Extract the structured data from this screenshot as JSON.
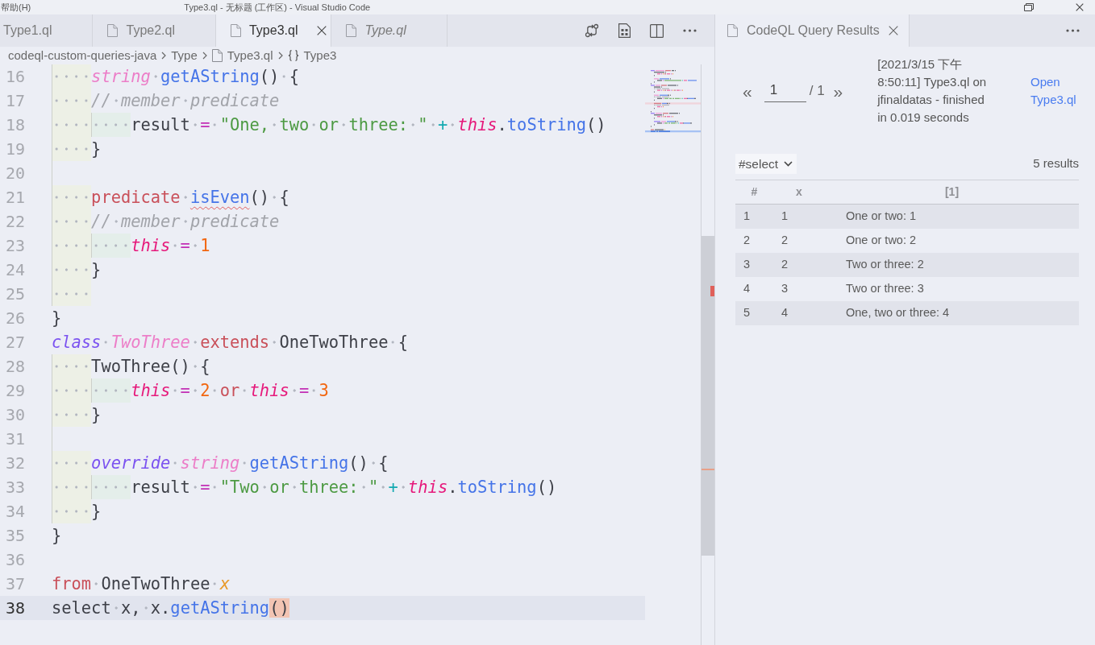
{
  "title_bar": {
    "menu": [
      "帮助(H)"
    ],
    "title": "Type3.ql - 无标题 (工作区) - Visual Studio Code"
  },
  "editor": {
    "tabs": [
      {
        "label": "Type1.ql",
        "selected": false,
        "preview": false,
        "icon": false
      },
      {
        "label": "Type2.ql",
        "selected": false,
        "preview": false,
        "icon": true
      },
      {
        "label": "Type3.ql",
        "selected": true,
        "preview": false,
        "icon": true
      },
      {
        "label": "Type.ql",
        "selected": false,
        "preview": true,
        "icon": true
      }
    ],
    "breadcrumbs": [
      {
        "kind": "folder",
        "label": "codeql-custom-queries-java"
      },
      {
        "kind": "folder",
        "label": "Type"
      },
      {
        "kind": "file",
        "label": "Type3.ql"
      },
      {
        "kind": "symbol",
        "label": "Type3"
      }
    ],
    "lines": [
      {
        "number": "16",
        "kind": "code",
        "current": false,
        "tokens": [
          {
            "kind": "type",
            "text": "    string "
          },
          {
            "kind": "function",
            "text": "getAString"
          },
          {
            "kind": "plain",
            "text": "() {"
          }
        ]
      },
      {
        "number": "17",
        "kind": "code",
        "current": false,
        "tokens": [
          {
            "kind": "comment",
            "text": "    // member predicate"
          }
        ]
      },
      {
        "number": "18",
        "kind": "code",
        "current": false,
        "tokens": [
          {
            "kind": "plain",
            "text": "        result "
          },
          {
            "kind": "comparison",
            "text": "= "
          },
          {
            "kind": "string",
            "text": "\"One, two or three: \" "
          },
          {
            "kind": "arithmetic",
            "text": "+ "
          },
          {
            "kind": "self",
            "text": "this"
          },
          {
            "kind": "plain",
            "text": "."
          },
          {
            "kind": "function",
            "text": "toString"
          },
          {
            "kind": "plain",
            "text": "()"
          }
        ]
      },
      {
        "number": "19",
        "kind": "code",
        "current": false,
        "tokens": [
          {
            "kind": "plain",
            "text": "    }"
          }
        ]
      },
      {
        "number": "20",
        "kind": "blank",
        "current": false
      },
      {
        "number": "21",
        "kind": "code",
        "current": false,
        "tokens": [
          {
            "kind": "keyword",
            "text": "    predicate "
          },
          {
            "kind": "function-squiggle",
            "text": "isEven"
          },
          {
            "kind": "plain",
            "text": "() {"
          }
        ]
      },
      {
        "number": "22",
        "kind": "code",
        "current": false,
        "tokens": [
          {
            "kind": "comment",
            "text": "    // member predicate"
          }
        ]
      },
      {
        "number": "23",
        "kind": "code",
        "current": false,
        "tokens": [
          {
            "kind": "self",
            "text": "        this "
          },
          {
            "kind": "comparison",
            "text": "= "
          },
          {
            "kind": "number",
            "text": "1"
          }
        ]
      },
      {
        "number": "24",
        "kind": "code",
        "current": false,
        "tokens": [
          {
            "kind": "plain",
            "text": "    }"
          }
        ]
      },
      {
        "number": "25",
        "kind": "whitespace",
        "current": false
      },
      {
        "number": "26",
        "kind": "code",
        "current": false,
        "tokens": [
          {
            "kind": "plain",
            "text": "}"
          }
        ]
      },
      {
        "number": "27",
        "kind": "code",
        "current": false,
        "tokens": [
          {
            "kind": "storage",
            "text": "class "
          },
          {
            "kind": "type",
            "text": "TwoThree "
          },
          {
            "kind": "keyword",
            "text": "extends "
          },
          {
            "kind": "plain",
            "text": "OneTwoThree {"
          }
        ]
      },
      {
        "number": "28",
        "kind": "code",
        "current": false,
        "tokens": [
          {
            "kind": "plain",
            "text": "    TwoThree() {"
          }
        ]
      },
      {
        "number": "29",
        "kind": "code",
        "current": false,
        "tokens": [
          {
            "kind": "self",
            "text": "        this "
          },
          {
            "kind": "comparison",
            "text": "= "
          },
          {
            "kind": "number",
            "text": "2 "
          },
          {
            "kind": "keyword",
            "text": "or "
          },
          {
            "kind": "self",
            "text": "this "
          },
          {
            "kind": "comparison",
            "text": "= "
          },
          {
            "kind": "number",
            "text": "3"
          }
        ]
      },
      {
        "number": "30",
        "kind": "code",
        "current": false,
        "tokens": [
          {
            "kind": "plain",
            "text": "    }"
          }
        ]
      },
      {
        "number": "31",
        "kind": "blank",
        "current": false
      },
      {
        "number": "32",
        "kind": "code",
        "current": false,
        "tokens": [
          {
            "kind": "storage",
            "text": "    override "
          },
          {
            "kind": "type",
            "text": "string "
          },
          {
            "kind": "function",
            "text": "getAString"
          },
          {
            "kind": "plain",
            "text": "() {"
          }
        ]
      },
      {
        "number": "33",
        "kind": "code",
        "current": false,
        "tokens": [
          {
            "kind": "plain",
            "text": "        result "
          },
          {
            "kind": "comparison",
            "text": "= "
          },
          {
            "kind": "string",
            "text": "\"Two or three: \" "
          },
          {
            "kind": "arithmetic",
            "text": "+ "
          },
          {
            "kind": "self",
            "text": "this"
          },
          {
            "kind": "plain",
            "text": "."
          },
          {
            "kind": "function",
            "text": "toString"
          },
          {
            "kind": "plain",
            "text": "()"
          }
        ]
      },
      {
        "number": "34",
        "kind": "code",
        "current": false,
        "tokens": [
          {
            "kind": "plain",
            "text": "    }"
          }
        ]
      },
      {
        "number": "35",
        "kind": "code",
        "current": false,
        "tokens": [
          {
            "kind": "plain",
            "text": "}"
          }
        ]
      },
      {
        "number": "36",
        "kind": "blank",
        "current": false
      },
      {
        "number": "37",
        "kind": "code",
        "current": false,
        "tokens": [
          {
            "kind": "keyword",
            "text": "from "
          },
          {
            "kind": "plain",
            "text": "OneTwoThree "
          },
          {
            "kind": "variable",
            "text": "x"
          }
        ]
      },
      {
        "number": "38",
        "kind": "code",
        "current": true,
        "tokens": [
          {
            "kind": "plain",
            "text": "select x, x."
          },
          {
            "kind": "function",
            "text": "getAString"
          },
          {
            "kind": "bracket-match",
            "text": "()"
          }
        ]
      }
    ]
  },
  "results_panel": {
    "tab": {
      "label": "CodeQL Query Results"
    },
    "pager": {
      "previous": "«",
      "page": "1",
      "total": "/ 1",
      "next": "»"
    },
    "summary": "[2021/3/15 下午 8:50:11] Type3.ql on jfinaldatas - finished in 0.019 seconds",
    "open_link": "Open Type3.ql",
    "result_set": {
      "value": "#select"
    },
    "count": "5 results",
    "table": {
      "columns": [
        "#",
        "x",
        "[1]"
      ],
      "rows": [
        [
          "1",
          "1",
          "One or two: 1"
        ],
        [
          "2",
          "2",
          "One or two: 2"
        ],
        [
          "3",
          "2",
          "Two or three: 2"
        ],
        [
          "4",
          "3",
          "Two or three: 3"
        ],
        [
          "5",
          "4",
          "One, two or three: 4"
        ]
      ]
    }
  }
}
